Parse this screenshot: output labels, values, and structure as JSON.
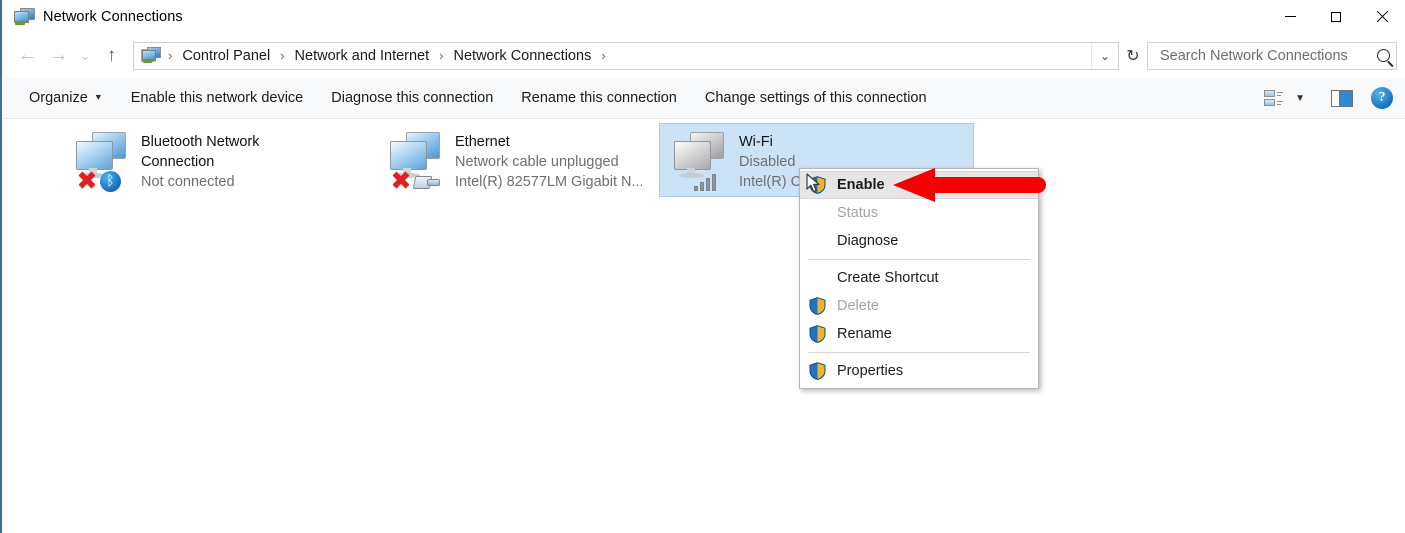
{
  "window": {
    "title": "Network Connections",
    "title_icon": "network-connections-icon",
    "minimize_label": "Minimize",
    "maximize_label": "Maximize",
    "close_label": "Close"
  },
  "nav": {
    "back": "back-arrow",
    "back_glyph": "←",
    "forward_glyph": "→",
    "recent_glyph": "⌄",
    "up_glyph": "↑",
    "refresh_glyph": "↻",
    "dropdown_glyph": "⌄"
  },
  "breadcrumb": {
    "separator": "›",
    "items": [
      {
        "label": "Control Panel"
      },
      {
        "label": "Network and Internet"
      },
      {
        "label": "Network Connections"
      }
    ]
  },
  "search": {
    "placeholder": "Search Network Connections",
    "value": ""
  },
  "toolbar": {
    "organize_label": "Organize",
    "organize_caret": "▼",
    "commands": [
      {
        "label": "Enable this network device"
      },
      {
        "label": "Diagnose this connection"
      },
      {
        "label": "Rename this connection"
      },
      {
        "label": "Change settings of this connection"
      }
    ],
    "view_caret": "▼",
    "help_label": "?"
  },
  "connections": [
    {
      "name": "Bluetooth Network\nConnection",
      "status": "Not connected",
      "device": "",
      "selected": false,
      "icon_state": "disconnected",
      "badge": "bluetooth",
      "bluetooth_glyph": "ᛒ"
    },
    {
      "name": "Ethernet",
      "status": "Network cable unplugged",
      "device": "Intel(R) 82577LM Gigabit N...",
      "selected": false,
      "icon_state": "disconnected",
      "badge": "rj45"
    },
    {
      "name": "Wi-Fi",
      "status": "Disabled",
      "device": "Intel(R) Centrino(R) Advance...",
      "selected": true,
      "icon_state": "disabled",
      "badge": "signal-bars"
    }
  ],
  "context_menu": {
    "items": [
      {
        "label": "Enable",
        "shield": true,
        "disabled": false,
        "highlighted": true
      },
      {
        "label": "Status",
        "shield": false,
        "disabled": true,
        "highlighted": false
      },
      {
        "label": "Diagnose",
        "shield": false,
        "disabled": false,
        "highlighted": false
      },
      {
        "separator": true
      },
      {
        "label": "Create Shortcut",
        "shield": false,
        "disabled": false,
        "highlighted": false
      },
      {
        "label": "Delete",
        "shield": true,
        "disabled": true,
        "highlighted": false
      },
      {
        "label": "Rename",
        "shield": true,
        "disabled": false,
        "highlighted": false
      },
      {
        "separator": true
      },
      {
        "label": "Properties",
        "shield": true,
        "disabled": false,
        "highlighted": false
      }
    ]
  },
  "annotation": {
    "arrow_color": "#f40000",
    "points_to": "Enable"
  },
  "colors": {
    "accent": "#3b6ea5",
    "selection": "#cce3f7",
    "commandbar": "#f7f9fb",
    "annotation_red": "#f40000"
  }
}
